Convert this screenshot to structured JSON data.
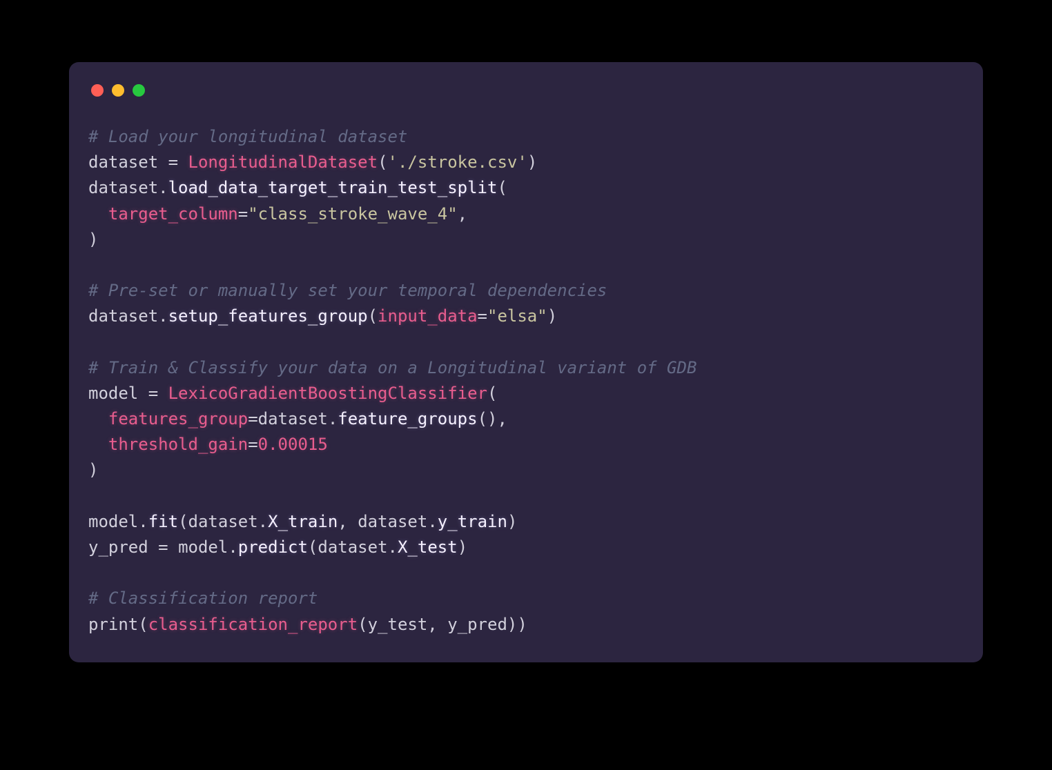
{
  "code": {
    "lines": [
      {
        "tokens": [
          {
            "cls": "tok-comment",
            "txt": "# Load your longitudinal dataset"
          }
        ]
      },
      {
        "tokens": [
          {
            "cls": "tok-var",
            "txt": "dataset"
          },
          {
            "cls": "tok-op",
            "txt": " = "
          },
          {
            "cls": "tok-class",
            "txt": "LongitudinalDataset"
          },
          {
            "cls": "tok-punc",
            "txt": "("
          },
          {
            "cls": "tok-string",
            "txt": "'./stroke.csv'"
          },
          {
            "cls": "tok-punc",
            "txt": ")"
          }
        ]
      },
      {
        "tokens": [
          {
            "cls": "tok-var",
            "txt": "dataset"
          },
          {
            "cls": "tok-punc",
            "txt": "."
          },
          {
            "cls": "tok-method",
            "txt": "load_data_target_train_test_split"
          },
          {
            "cls": "tok-punc",
            "txt": "("
          }
        ]
      },
      {
        "tokens": [
          {
            "cls": "tok-var",
            "txt": "  "
          },
          {
            "cls": "tok-kwarg",
            "txt": "target_column"
          },
          {
            "cls": "tok-op",
            "txt": "="
          },
          {
            "cls": "tok-string",
            "txt": "\"class_stroke_wave_4\""
          },
          {
            "cls": "tok-punc",
            "txt": ","
          }
        ]
      },
      {
        "tokens": [
          {
            "cls": "tok-punc",
            "txt": ")"
          }
        ]
      },
      {
        "tokens": [
          {
            "cls": "tok-var",
            "txt": ""
          }
        ]
      },
      {
        "tokens": [
          {
            "cls": "tok-comment",
            "txt": "# Pre-set or manually set your temporal dependencies"
          }
        ]
      },
      {
        "tokens": [
          {
            "cls": "tok-var",
            "txt": "dataset"
          },
          {
            "cls": "tok-punc",
            "txt": "."
          },
          {
            "cls": "tok-method",
            "txt": "setup_features_group"
          },
          {
            "cls": "tok-punc",
            "txt": "("
          },
          {
            "cls": "tok-kwarg",
            "txt": "input_data"
          },
          {
            "cls": "tok-op",
            "txt": "="
          },
          {
            "cls": "tok-string",
            "txt": "\"elsa\""
          },
          {
            "cls": "tok-punc",
            "txt": ")"
          }
        ]
      },
      {
        "tokens": [
          {
            "cls": "tok-var",
            "txt": ""
          }
        ]
      },
      {
        "tokens": [
          {
            "cls": "tok-comment",
            "txt": "# Train & Classify your data on a Longitudinal variant of GDB"
          }
        ]
      },
      {
        "tokens": [
          {
            "cls": "tok-var",
            "txt": "model"
          },
          {
            "cls": "tok-op",
            "txt": " = "
          },
          {
            "cls": "tok-class",
            "txt": "LexicoGradientBoostingClassifier"
          },
          {
            "cls": "tok-punc",
            "txt": "("
          }
        ]
      },
      {
        "tokens": [
          {
            "cls": "tok-var",
            "txt": "  "
          },
          {
            "cls": "tok-kwarg",
            "txt": "features_group"
          },
          {
            "cls": "tok-op",
            "txt": "="
          },
          {
            "cls": "tok-var",
            "txt": "dataset"
          },
          {
            "cls": "tok-punc",
            "txt": "."
          },
          {
            "cls": "tok-method",
            "txt": "feature_groups"
          },
          {
            "cls": "tok-punc",
            "txt": "(),"
          }
        ]
      },
      {
        "tokens": [
          {
            "cls": "tok-var",
            "txt": "  "
          },
          {
            "cls": "tok-kwarg",
            "txt": "threshold_gain"
          },
          {
            "cls": "tok-op",
            "txt": "="
          },
          {
            "cls": "tok-number",
            "txt": "0.00015"
          }
        ]
      },
      {
        "tokens": [
          {
            "cls": "tok-punc",
            "txt": ")"
          }
        ]
      },
      {
        "tokens": [
          {
            "cls": "tok-var",
            "txt": ""
          }
        ]
      },
      {
        "tokens": [
          {
            "cls": "tok-var",
            "txt": "model"
          },
          {
            "cls": "tok-punc",
            "txt": "."
          },
          {
            "cls": "tok-method",
            "txt": "fit"
          },
          {
            "cls": "tok-punc",
            "txt": "("
          },
          {
            "cls": "tok-var",
            "txt": "dataset"
          },
          {
            "cls": "tok-punc",
            "txt": "."
          },
          {
            "cls": "tok-attr",
            "txt": "X_train"
          },
          {
            "cls": "tok-punc",
            "txt": ", "
          },
          {
            "cls": "tok-var",
            "txt": "dataset"
          },
          {
            "cls": "tok-punc",
            "txt": "."
          },
          {
            "cls": "tok-attr",
            "txt": "y_train"
          },
          {
            "cls": "tok-punc",
            "txt": ")"
          }
        ]
      },
      {
        "tokens": [
          {
            "cls": "tok-var",
            "txt": "y_pred"
          },
          {
            "cls": "tok-op",
            "txt": " = "
          },
          {
            "cls": "tok-var",
            "txt": "model"
          },
          {
            "cls": "tok-punc",
            "txt": "."
          },
          {
            "cls": "tok-method",
            "txt": "predict"
          },
          {
            "cls": "tok-punc",
            "txt": "("
          },
          {
            "cls": "tok-var",
            "txt": "dataset"
          },
          {
            "cls": "tok-punc",
            "txt": "."
          },
          {
            "cls": "tok-attr",
            "txt": "X_test"
          },
          {
            "cls": "tok-punc",
            "txt": ")"
          }
        ]
      },
      {
        "tokens": [
          {
            "cls": "tok-var",
            "txt": ""
          }
        ]
      },
      {
        "tokens": [
          {
            "cls": "tok-comment",
            "txt": "# Classification report"
          }
        ]
      },
      {
        "tokens": [
          {
            "cls": "tok-builtin",
            "txt": "print"
          },
          {
            "cls": "tok-punc",
            "txt": "("
          },
          {
            "cls": "tok-kwarg",
            "txt": "classification_report"
          },
          {
            "cls": "tok-punc",
            "txt": "("
          },
          {
            "cls": "tok-var",
            "txt": "y_test"
          },
          {
            "cls": "tok-punc",
            "txt": ", "
          },
          {
            "cls": "tok-var",
            "txt": "y_pred"
          },
          {
            "cls": "tok-punc",
            "txt": "))"
          }
        ]
      }
    ]
  },
  "colors": {
    "window_bg": "#2c2540",
    "red": "#ff5f56",
    "yellow": "#ffbd2e",
    "green": "#27c93f"
  }
}
